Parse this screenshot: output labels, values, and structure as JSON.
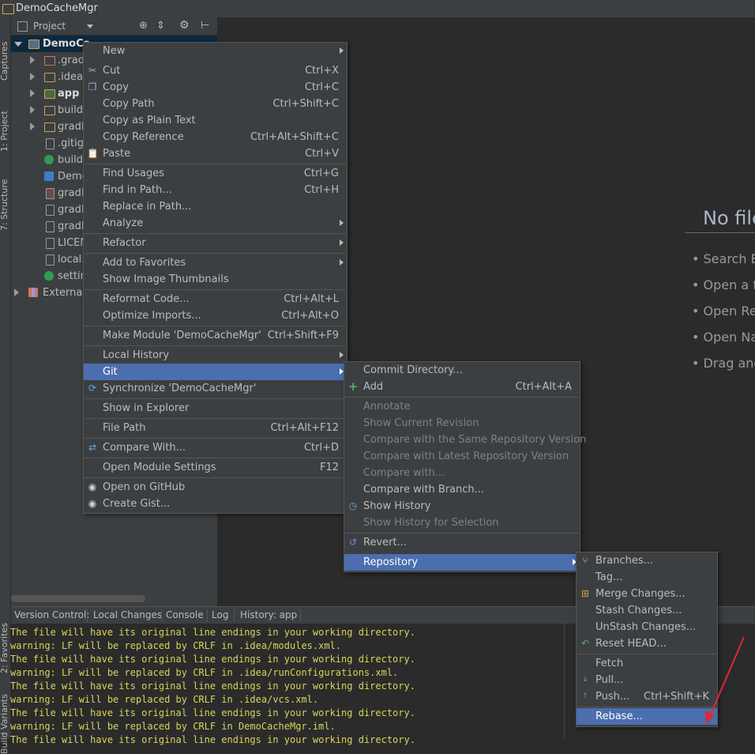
{
  "window": {
    "title": "DemoCacheMgr"
  },
  "left_strip": {
    "tabs": [
      "Captures",
      "1: Project",
      "7: Structure",
      "2: Favorites",
      "Build Variants"
    ]
  },
  "project_panel": {
    "header_label": "Project",
    "tree": [
      {
        "label": "DemoCa",
        "type": "module-root"
      },
      {
        "label": ".grad",
        "type": "folder"
      },
      {
        "label": ".idea",
        "type": "folder"
      },
      {
        "label": "app",
        "type": "module"
      },
      {
        "label": "build",
        "type": "folder"
      },
      {
        "label": "gradl",
        "type": "folder"
      },
      {
        "label": ".gitig",
        "type": "file"
      },
      {
        "label": "build.",
        "type": "gradle"
      },
      {
        "label": "Demo",
        "type": "iml"
      },
      {
        "label": "gradl",
        "type": "file"
      },
      {
        "label": "gradl",
        "type": "file"
      },
      {
        "label": "gradl",
        "type": "file"
      },
      {
        "label": "LICEN",
        "type": "file"
      },
      {
        "label": "local.",
        "type": "file"
      },
      {
        "label": "settin",
        "type": "gradle"
      },
      {
        "label": "External",
        "type": "libraries"
      }
    ]
  },
  "editor": {
    "empty_title": "No file",
    "hints": [
      "• Search E",
      "• Open a f",
      "• Open Re",
      "• Open Na",
      "• Drag and"
    ]
  },
  "context_menu": {
    "items": [
      {
        "label": "New",
        "shortcut": "",
        "submenu": true
      },
      {
        "label": "Cut",
        "shortcut": "Ctrl+X",
        "icon": "scissors-icon"
      },
      {
        "label": "Copy",
        "shortcut": "Ctrl+C",
        "icon": "copy-icon"
      },
      {
        "label": "Copy Path",
        "shortcut": "Ctrl+Shift+C"
      },
      {
        "label": "Copy as Plain Text",
        "shortcut": ""
      },
      {
        "label": "Copy Reference",
        "shortcut": "Ctrl+Alt+Shift+C"
      },
      {
        "label": "Paste",
        "shortcut": "Ctrl+V",
        "icon": "paste-icon"
      },
      {
        "label": "Find Usages",
        "shortcut": "Ctrl+G"
      },
      {
        "label": "Find in Path...",
        "shortcut": "Ctrl+H"
      },
      {
        "label": "Replace in Path...",
        "shortcut": ""
      },
      {
        "label": "Analyze",
        "shortcut": "",
        "submenu": true
      },
      {
        "label": "Refactor",
        "shortcut": "",
        "submenu": true
      },
      {
        "label": "Add to Favorites",
        "shortcut": "",
        "submenu": true
      },
      {
        "label": "Show Image Thumbnails",
        "shortcut": ""
      },
      {
        "label": "Reformat Code...",
        "shortcut": "Ctrl+Alt+L"
      },
      {
        "label": "Optimize Imports...",
        "shortcut": "Ctrl+Alt+O"
      },
      {
        "label": "Make Module 'DemoCacheMgr'",
        "shortcut": "Ctrl+Shift+F9"
      },
      {
        "label": "Local History",
        "shortcut": "",
        "submenu": true
      },
      {
        "label": "Git",
        "shortcut": "",
        "submenu": true,
        "selected": true
      },
      {
        "label": "Synchronize 'DemoCacheMgr'",
        "shortcut": "",
        "icon": "sync-icon"
      },
      {
        "label": "Show in Explorer",
        "shortcut": ""
      },
      {
        "label": "File Path",
        "shortcut": "Ctrl+Alt+F12"
      },
      {
        "label": "Compare With...",
        "shortcut": "Ctrl+D",
        "icon": "compare-icon"
      },
      {
        "label": "Open Module Settings",
        "shortcut": "F12"
      },
      {
        "label": "Open on GitHub",
        "shortcut": "",
        "icon": "github-icon"
      },
      {
        "label": "Create Gist...",
        "shortcut": "",
        "icon": "github-icon"
      }
    ]
  },
  "git_menu": {
    "items": [
      {
        "label": "Commit Directory...",
        "shortcut": ""
      },
      {
        "label": "Add",
        "shortcut": "Ctrl+Alt+A",
        "icon": "plus-icon"
      },
      {
        "label": "Annotate",
        "shortcut": "",
        "disabled": true
      },
      {
        "label": "Show Current Revision",
        "shortcut": "",
        "disabled": true
      },
      {
        "label": "Compare with the Same Repository Version",
        "shortcut": "",
        "disabled": true
      },
      {
        "label": "Compare with Latest Repository Version",
        "shortcut": "",
        "disabled": true
      },
      {
        "label": "Compare with...",
        "shortcut": "",
        "disabled": true
      },
      {
        "label": "Compare with Branch...",
        "shortcut": ""
      },
      {
        "label": "Show History",
        "shortcut": "",
        "icon": "history-icon"
      },
      {
        "label": "Show History for Selection",
        "shortcut": "",
        "disabled": true
      },
      {
        "label": "Revert...",
        "shortcut": "",
        "icon": "revert-icon"
      },
      {
        "label": "Repository",
        "shortcut": "",
        "submenu": true,
        "selected": true
      }
    ]
  },
  "repo_menu": {
    "items": [
      {
        "label": "Branches...",
        "shortcut": "",
        "icon": "branch-icon"
      },
      {
        "label": "Tag...",
        "shortcut": ""
      },
      {
        "label": "Merge Changes...",
        "shortcut": "",
        "icon": "merge-icon"
      },
      {
        "label": "Stash Changes...",
        "shortcut": ""
      },
      {
        "label": "UnStash Changes...",
        "shortcut": ""
      },
      {
        "label": "Reset HEAD...",
        "shortcut": "",
        "icon": "reset-icon"
      },
      {
        "label": "Fetch",
        "shortcut": ""
      },
      {
        "label": "Pull...",
        "shortcut": "",
        "icon": "vcs-pull-icon"
      },
      {
        "label": "Push...",
        "shortcut": "Ctrl+Shift+K",
        "icon": "vcs-push-icon"
      },
      {
        "label": "Rebase...",
        "shortcut": "",
        "selected": true
      }
    ]
  },
  "bottom_panel": {
    "tabs": [
      "Version Control:",
      "Local Changes",
      "Console",
      "Log",
      "History: app"
    ],
    "console_lines": [
      "The file will have its original line endings in your working directory.",
      "warning: LF will be replaced by CRLF in .idea/modules.xml.",
      "The file will have its original line endings in your working directory.",
      "warning: LF will be replaced by CRLF in .idea/runConfigurations.xml.",
      "The file will have its original line endings in your working directory.",
      "warning: LF will be replaced by CRLF in .idea/vcs.xml.",
      "The file will have its original line endings in your working directory.",
      "warning: LF will be replaced by CRLF in DemoCacheMgr.iml.",
      "The file will have its original line endings in your working directory."
    ]
  },
  "colors": {
    "selection": "#4b6eaf",
    "menu_bg": "#3c3f41",
    "console_text": "#d8d45c",
    "annotation": "#e0282e"
  }
}
